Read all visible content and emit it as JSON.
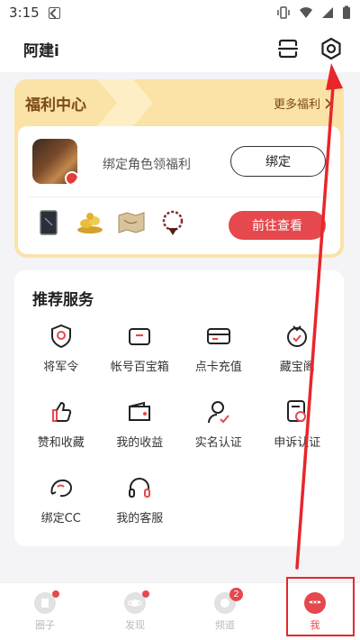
{
  "status_bar": {
    "time": "3:15"
  },
  "header": {
    "title": "阿建i"
  },
  "welfare": {
    "title": "福利中心",
    "more_label": "更多福利",
    "bind_prompt": "绑定角色领福利",
    "bind_button": "绑定",
    "goto_button": "前往查看"
  },
  "services": {
    "title": "推荐服务",
    "items": [
      {
        "label": "将军令",
        "icon": "general-order-icon"
      },
      {
        "label": "帐号百宝箱",
        "icon": "treasure-box-icon"
      },
      {
        "label": "点卡充值",
        "icon": "card-recharge-icon"
      },
      {
        "label": "藏宝阁",
        "icon": "treasure-pavilion-icon"
      },
      {
        "label": "赞和收藏",
        "icon": "thumbs-up-icon"
      },
      {
        "label": "我的收益",
        "icon": "wallet-icon"
      },
      {
        "label": "实名认证",
        "icon": "verify-user-icon"
      },
      {
        "label": "申诉认证",
        "icon": "appeal-icon"
      },
      {
        "label": "绑定CC",
        "icon": "cc-bind-icon"
      },
      {
        "label": "我的客服",
        "icon": "headset-icon"
      }
    ]
  },
  "bottom_nav": [
    {
      "label": "圈子",
      "badge": "dot"
    },
    {
      "label": "发现",
      "badge": "dot"
    },
    {
      "label": "频道",
      "badge": "2"
    },
    {
      "label": "我",
      "badge": ""
    }
  ],
  "colors": {
    "accent": "#e5484d",
    "welfare_bg": "#fbe2a7",
    "annotation": "#e8262c"
  }
}
